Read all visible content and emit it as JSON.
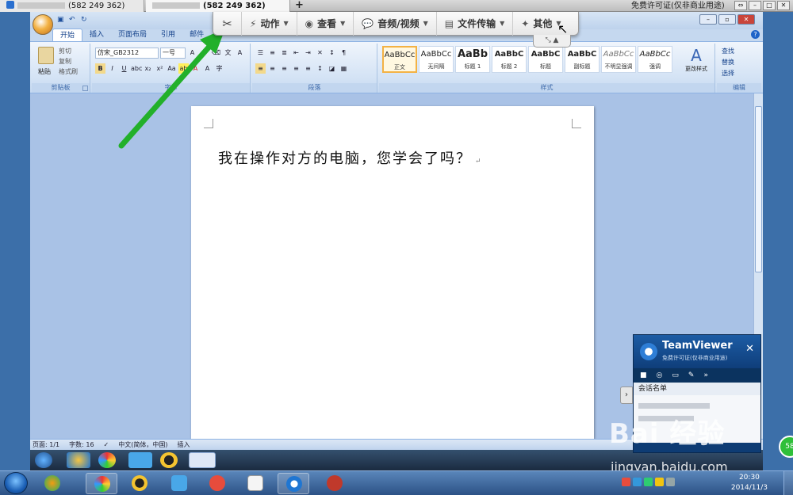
{
  "tv_strip": {
    "tab1_id": "(582 249 362)",
    "tab2_id": "(582 249 362)",
    "plus": "+",
    "license": "免费许可证(仅非商业用途)"
  },
  "tv_toolbar": {
    "menus": [
      {
        "icon": "⚡",
        "label": "动作"
      },
      {
        "icon": "◉",
        "label": "查看"
      },
      {
        "icon": "💬",
        "label": "音频/视频"
      },
      {
        "icon": "▤",
        "label": "文件传输"
      },
      {
        "icon": "✦",
        "label": "其他"
      }
    ],
    "tab_glyph": "⤡ ▲"
  },
  "word": {
    "tabs": [
      "开始",
      "插入",
      "页面布局",
      "引用",
      "邮件"
    ],
    "clipboard": {
      "paste": "粘贴",
      "cut": "剪切",
      "copy": "复制",
      "format_painter": "格式刷",
      "group": "剪贴板"
    },
    "font": {
      "name": "仿宋_GB2312",
      "size": "一号",
      "group": "字体"
    },
    "paragraph_group": "段落",
    "styles": {
      "group": "样式",
      "change": "更改样式",
      "tiles": [
        {
          "sample": "AaBbCc",
          "name": "正文"
        },
        {
          "sample": "AaBbCc",
          "name": "无间隔"
        },
        {
          "sample": "AaBb",
          "name": "标题 1"
        },
        {
          "sample": "AaBbC",
          "name": "标题 2"
        },
        {
          "sample": "AaBbC",
          "name": "标题"
        },
        {
          "sample": "AaBbC",
          "name": "副标题"
        },
        {
          "sample": "AaBbCc",
          "name": "不明显强调"
        },
        {
          "sample": "AaBbCc",
          "name": "强调"
        }
      ]
    },
    "editing": {
      "find": "查找",
      "replace": "替换",
      "select": "选择",
      "group": "编辑"
    },
    "document_text": "我在操作对方的电脑，您学会了吗？",
    "status": {
      "page": "页面: 1/1",
      "words": "字数: 16",
      "lang": "中文(简体，中国)",
      "mode": "插入"
    }
  },
  "tv_panel": {
    "name": "TeamViewer",
    "subtitle": "免费许可证(仅非商业用途)",
    "session_list": "会话名单"
  },
  "watermark": {
    "logo": "Bai 经验",
    "url": "jingyan.baidu.com"
  },
  "taskbar": {
    "time": "20:30",
    "date": "2014/11/3",
    "badge": "58"
  },
  "colors": {
    "arrow": "#22b02a",
    "ribbon": "#d4e3f5",
    "tv_panel": "#0e3c74"
  }
}
